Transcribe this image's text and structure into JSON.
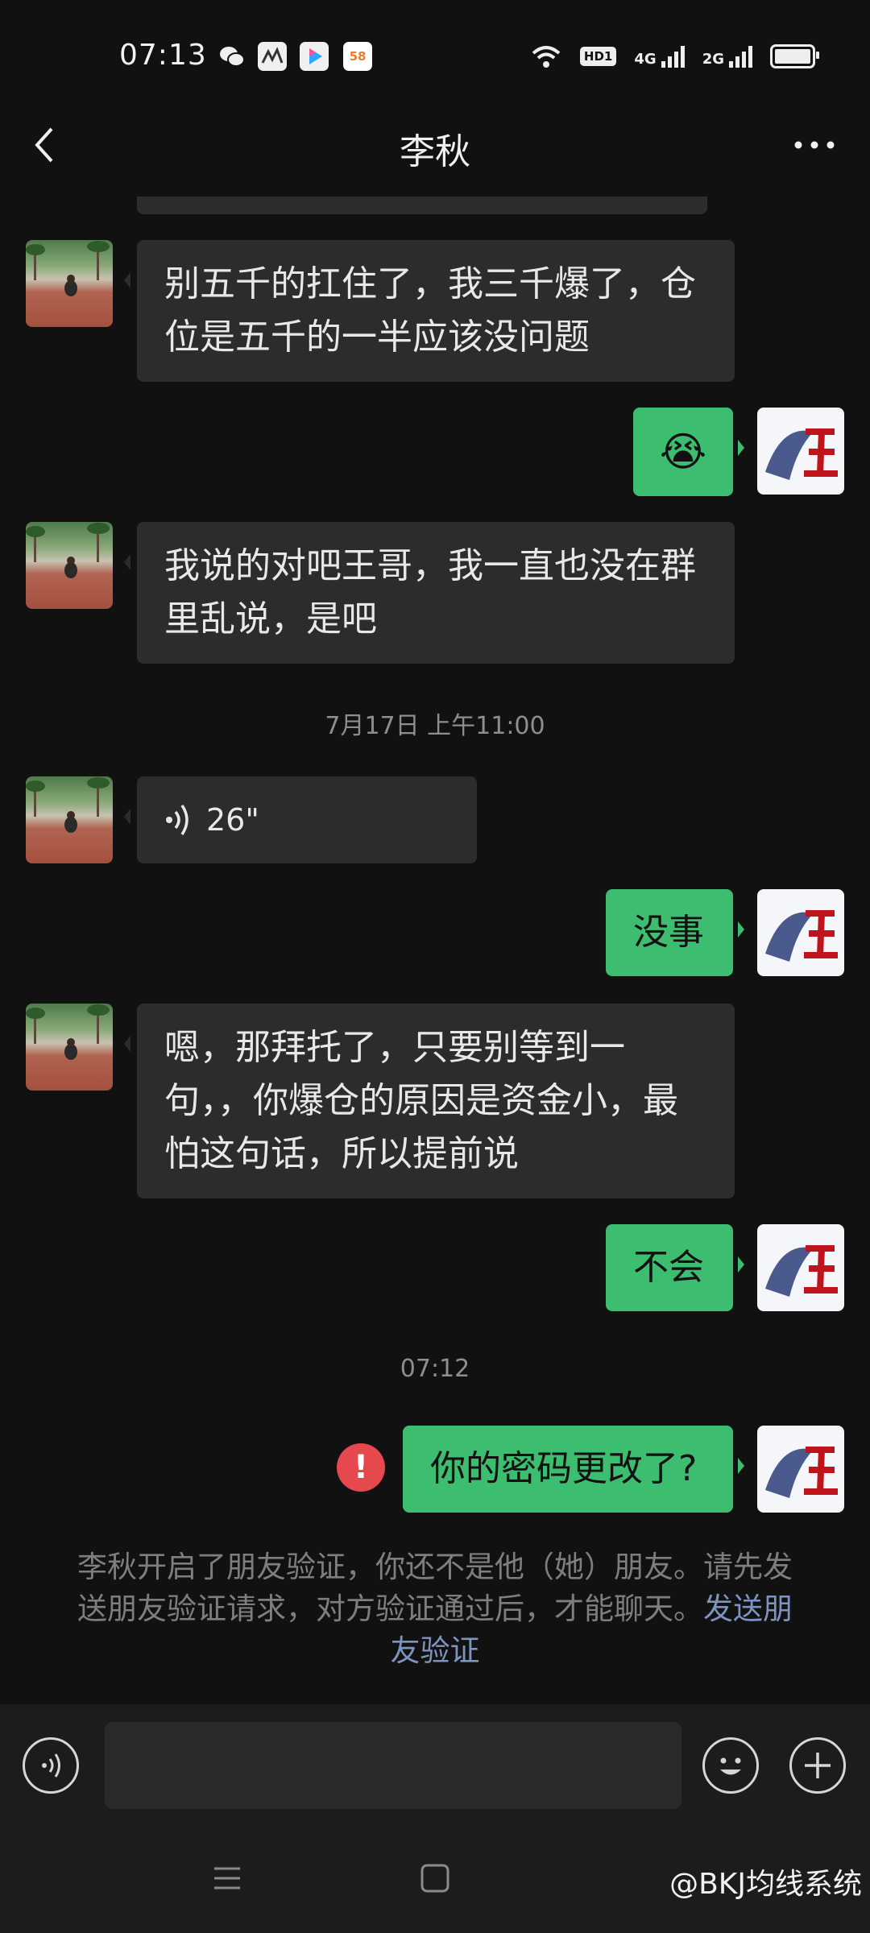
{
  "status_bar": {
    "time": "07:13",
    "app_icons": [
      "wechat-icon",
      "news-app-icon",
      "youku-icon",
      "58-app-icon"
    ],
    "network_1": "4G",
    "network_2": "2G",
    "hd_label": "HD1"
  },
  "header": {
    "title": "李秋",
    "back_icon": "chevron-left-icon",
    "more_icon": "more-dots-icon"
  },
  "messages": {
    "m1": "别五千的扛住了，我三千爆了，仓位是五千的一半应该没问题",
    "m1_l1": "别五千的扛住了，我三千爆了，仓",
    "m1_l2": "位是五千的一半应该没问题",
    "m2_emoji": "😭",
    "m3_l1": "我说的对吧王哥，我一直也没在群",
    "m3_l2": "里乱说，是吧",
    "ts1": "7月17日 上午11:00",
    "voice_duration": "26\"",
    "m5": "没事",
    "m6_l1": "嗯，那拜托了，只要别等到一",
    "m6_l2": "句，，你爆仓的原因是资金小，最",
    "m6_l3": "怕这句话，所以提前说",
    "m7": "不会",
    "ts2": "07:12",
    "m8": "你的密码更改了?",
    "failed_icon": "!"
  },
  "notice": {
    "text": "李秋开启了朋友验证，你还不是他（她）朋友。请先发送朋友验证请求，对方验证通过后，才能聊天。",
    "link": "发送朋友验证"
  },
  "input_bar": {
    "voice_icon": "voice-input-icon",
    "emoji_icon": "emoji-icon",
    "plus_icon": "plus-icon",
    "placeholder": ""
  },
  "watermark": "@BKJ均线系统",
  "colors": {
    "background": "#111111",
    "sent_bubble": "#3cbd6f",
    "received_bubble": "#2c2c2c",
    "error": "#e5484d",
    "link": "#7d94c0"
  }
}
